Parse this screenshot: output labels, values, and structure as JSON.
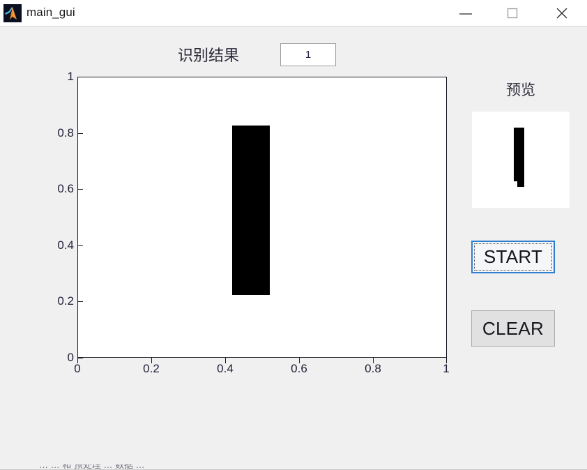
{
  "window": {
    "title": "main_gui",
    "icon": "matlab-logo-icon",
    "background_color": "#f0f0f0",
    "controls": {
      "minimize": "minimize-icon",
      "maximize": "maximize-icon",
      "close": "close-icon"
    }
  },
  "header": {
    "result_label": "识别结果",
    "result_value": "1"
  },
  "plot": {
    "background_color": "#ffffff",
    "stroke_color": "#000000",
    "xticks": [
      "0",
      "0.2",
      "0.4",
      "0.6",
      "0.8",
      "1"
    ],
    "yticks": [
      "0",
      "0.2",
      "0.4",
      "0.6",
      "0.8",
      "1"
    ]
  },
  "chart_data": {
    "type": "scatter",
    "title": "",
    "xlabel": "",
    "ylabel": "",
    "xlim": [
      0,
      1
    ],
    "ylim": [
      0,
      1
    ],
    "grid": false,
    "legend": "none",
    "categories": [
      "0",
      "0.2",
      "0.4",
      "0.6",
      "0.8",
      "1"
    ],
    "values": [
      0,
      0,
      0,
      0,
      0,
      0
    ],
    "annotations": [
      {
        "label": "handwritten-digit-stroke",
        "shape": "rectangle",
        "x0": 0.419,
        "x1": 0.521,
        "y0": 0.221,
        "y1": 0.827,
        "color": "#000000"
      }
    ]
  },
  "preview": {
    "label": "预览",
    "background_color": "#ffffff",
    "stroke_color": "#000000"
  },
  "buttons": {
    "start": "START",
    "clear": "CLEAR",
    "start_focus_color": "#2f7fd1",
    "clear_background": "#e1e1e1"
  },
  "bottom": {
    "clipped_text": "… … 和 预处理 … 数据 …"
  }
}
